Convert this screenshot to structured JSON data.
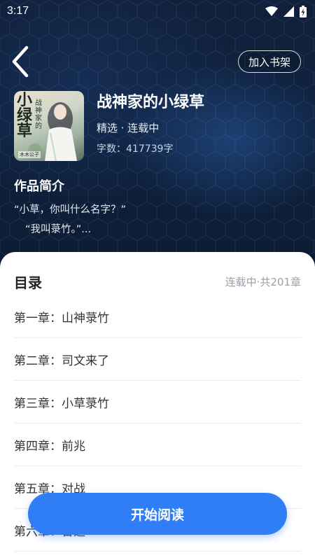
{
  "status_bar": {
    "time": "3:17"
  },
  "header": {
    "shelf_button_label": "加入书架"
  },
  "book": {
    "title": "战神家的小绿草",
    "meta": "精选 · 连载中",
    "word_count": "字数：417739字",
    "cover_text": {
      "main": "小绿草",
      "sub": "战神家的",
      "author": "木木公子"
    }
  },
  "intro": {
    "heading": "作品简介",
    "line1": "“小草，你叫什么名字？”",
    "line2": "“我叫菉竹。”..."
  },
  "toc": {
    "title": "目录",
    "status": "连载中·共201章",
    "chapters": [
      "第一章：山神菉竹",
      "第二章：司文来了",
      "第三章：小草菉竹",
      "第四章：前兆",
      "第五章：对战",
      "第六章：台选"
    ]
  },
  "actions": {
    "read_label": "开始阅读"
  },
  "colors": {
    "accent": "#2f7ef6",
    "hero_bg": "#10203a"
  }
}
